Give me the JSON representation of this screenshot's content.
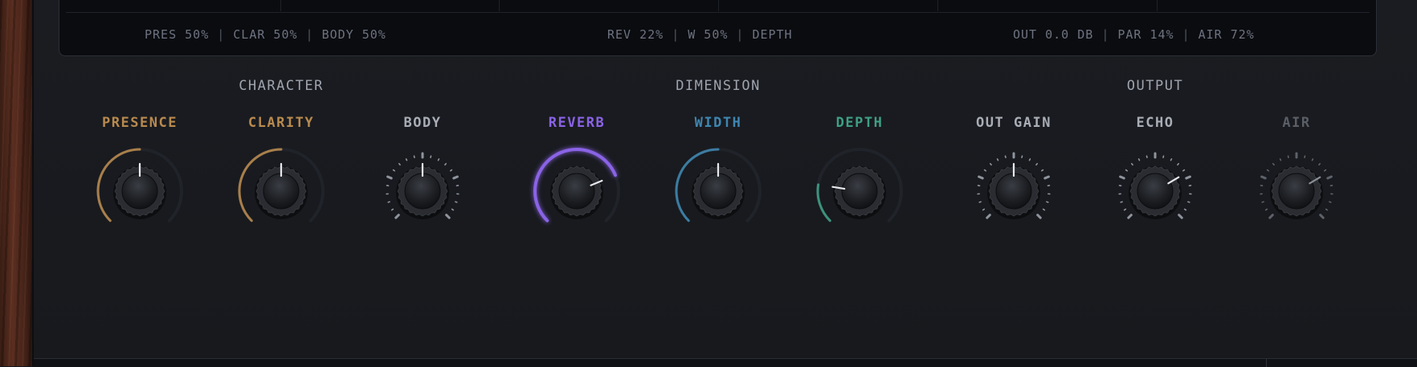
{
  "readouts": {
    "character": [
      "PRES 50%",
      "CLAR 50%",
      "BODY 50%"
    ],
    "dimension": [
      "REV 22%",
      "W 50%",
      "DEPTH"
    ],
    "output": [
      "OUT 0.0 DB",
      "PAR 14%",
      "AIR 72%"
    ],
    "separator": "|"
  },
  "groups": [
    {
      "title": "CHARACTER"
    },
    {
      "title": "DIMENSION"
    },
    {
      "title": "OUTPUT"
    }
  ],
  "knobs": [
    {
      "id": "presence",
      "label": "PRESENCE",
      "color": "#b88a4e",
      "style": "arc",
      "value": 0.5,
      "dim": false,
      "glow": false
    },
    {
      "id": "clarity",
      "label": "CLARITY",
      "color": "#b88a4e",
      "style": "arc",
      "value": 0.5,
      "dim": false,
      "glow": false
    },
    {
      "id": "body",
      "label": "BODY",
      "color": "#a9adb5",
      "style": "ticks",
      "value": 0.5,
      "dim": false,
      "glow": false
    },
    {
      "id": "reverb",
      "label": "REVERB",
      "color": "#8a63e6",
      "style": "arc",
      "value": 0.75,
      "dim": false,
      "glow": true
    },
    {
      "id": "width",
      "label": "WIDTH",
      "color": "#3f86b0",
      "style": "arc",
      "value": 0.5,
      "dim": false,
      "glow": false
    },
    {
      "id": "depth",
      "label": "DEPTH",
      "color": "#3f9f86",
      "style": "arc",
      "value": 0.2,
      "dim": false,
      "glow": false
    },
    {
      "id": "out-gain",
      "label": "OUT GAIN",
      "color": "#a9adb5",
      "style": "ticks",
      "value": 0.5,
      "dim": false,
      "glow": false
    },
    {
      "id": "echo",
      "label": "ECHO",
      "color": "#a9adb5",
      "style": "ticks",
      "value": 0.72,
      "dim": false,
      "glow": false
    },
    {
      "id": "air",
      "label": "AIR",
      "color": "#5a5e66",
      "style": "ticks",
      "value": 0.72,
      "dim": true,
      "glow": false
    }
  ]
}
